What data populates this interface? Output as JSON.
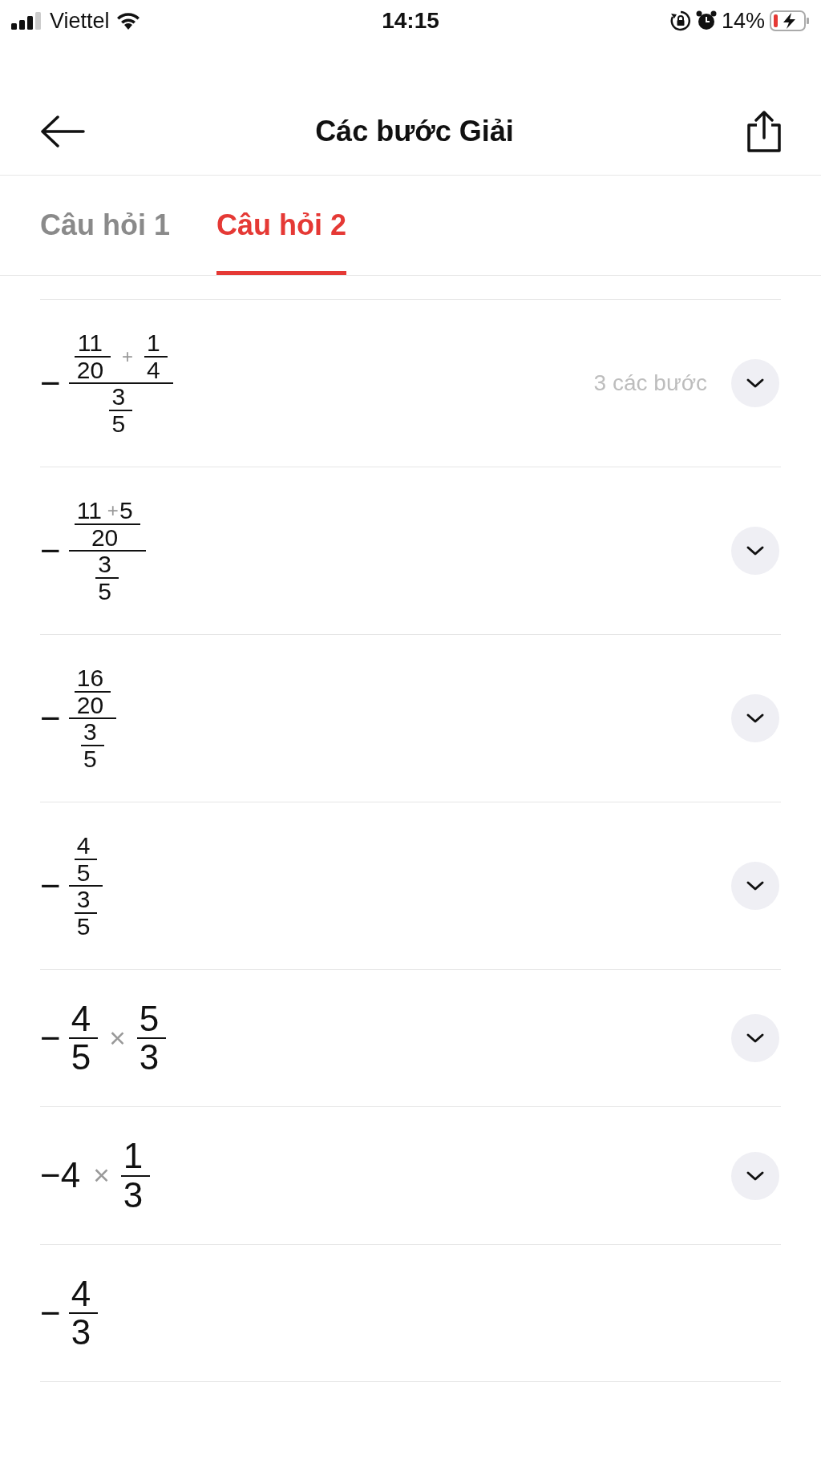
{
  "status_bar": {
    "carrier": "Viettel",
    "time": "14:15",
    "battery": "14%"
  },
  "header": {
    "title": "Các bước Giải"
  },
  "tabs": [
    {
      "label": "Câu hỏi 1",
      "selected": false
    },
    {
      "label": "Câu hỏi 2",
      "selected": true
    }
  ],
  "steps": [
    {
      "expression": [
        {
          "kind": "text",
          "text": "−"
        },
        {
          "kind": "frac",
          "num": [
            {
              "kind": "frac",
              "num": [
                {
                  "kind": "text",
                  "text": "11"
                }
              ],
              "den": [
                {
                  "kind": "text",
                  "text": "20"
                }
              ]
            },
            {
              "kind": "op",
              "text": "+"
            },
            {
              "kind": "frac",
              "num": [
                {
                  "kind": "text",
                  "text": "1"
                }
              ],
              "den": [
                {
                  "kind": "text",
                  "text": "4"
                }
              ]
            }
          ],
          "den": [
            {
              "kind": "frac",
              "num": [
                {
                  "kind": "text",
                  "text": "3"
                }
              ],
              "den": [
                {
                  "kind": "text",
                  "text": "5"
                }
              ]
            }
          ]
        }
      ],
      "step_count": "3 các bước",
      "expandable": true
    },
    {
      "expression": [
        {
          "kind": "text",
          "text": "−"
        },
        {
          "kind": "frac",
          "num": [
            {
              "kind": "frac",
              "num": [
                {
                  "kind": "text",
                  "text": "11"
                },
                {
                  "kind": "op",
                  "text": "+"
                },
                {
                  "kind": "text",
                  "text": "5"
                }
              ],
              "den": [
                {
                  "kind": "text",
                  "text": "20"
                }
              ]
            }
          ],
          "den": [
            {
              "kind": "frac",
              "num": [
                {
                  "kind": "text",
                  "text": "3"
                }
              ],
              "den": [
                {
                  "kind": "text",
                  "text": "5"
                }
              ]
            }
          ]
        }
      ],
      "expandable": true
    },
    {
      "expression": [
        {
          "kind": "text",
          "text": "−"
        },
        {
          "kind": "frac",
          "num": [
            {
              "kind": "frac",
              "num": [
                {
                  "kind": "text",
                  "text": "16"
                }
              ],
              "den": [
                {
                  "kind": "text",
                  "text": "20"
                }
              ]
            }
          ],
          "den": [
            {
              "kind": "frac",
              "num": [
                {
                  "kind": "text",
                  "text": "3"
                }
              ],
              "den": [
                {
                  "kind": "text",
                  "text": "5"
                }
              ]
            }
          ]
        }
      ],
      "expandable": true
    },
    {
      "expression": [
        {
          "kind": "text",
          "text": "−"
        },
        {
          "kind": "frac",
          "num": [
            {
              "kind": "frac",
              "num": [
                {
                  "kind": "text",
                  "text": "4"
                }
              ],
              "den": [
                {
                  "kind": "text",
                  "text": "5"
                }
              ]
            }
          ],
          "den": [
            {
              "kind": "frac",
              "num": [
                {
                  "kind": "text",
                  "text": "3"
                }
              ],
              "den": [
                {
                  "kind": "text",
                  "text": "5"
                }
              ]
            }
          ]
        }
      ],
      "expandable": true
    },
    {
      "expression": [
        {
          "kind": "text",
          "text": "−"
        },
        {
          "kind": "frac",
          "num": [
            {
              "kind": "text",
              "text": "4"
            }
          ],
          "den": [
            {
              "kind": "text",
              "text": "5"
            }
          ]
        },
        {
          "kind": "op",
          "text": "×"
        },
        {
          "kind": "frac",
          "num": [
            {
              "kind": "text",
              "text": "5"
            }
          ],
          "den": [
            {
              "kind": "text",
              "text": "3"
            }
          ]
        }
      ],
      "expandable": true
    },
    {
      "expression": [
        {
          "kind": "text",
          "text": "−4"
        },
        {
          "kind": "op",
          "text": "×"
        },
        {
          "kind": "frac",
          "num": [
            {
              "kind": "text",
              "text": "1"
            }
          ],
          "den": [
            {
              "kind": "text",
              "text": "3"
            }
          ]
        }
      ],
      "expandable": true
    },
    {
      "expression": [
        {
          "kind": "text",
          "text": "−"
        },
        {
          "kind": "frac",
          "num": [
            {
              "kind": "text",
              "text": "4"
            }
          ],
          "den": [
            {
              "kind": "text",
              "text": "3"
            }
          ]
        }
      ],
      "expandable": false
    }
  ]
}
